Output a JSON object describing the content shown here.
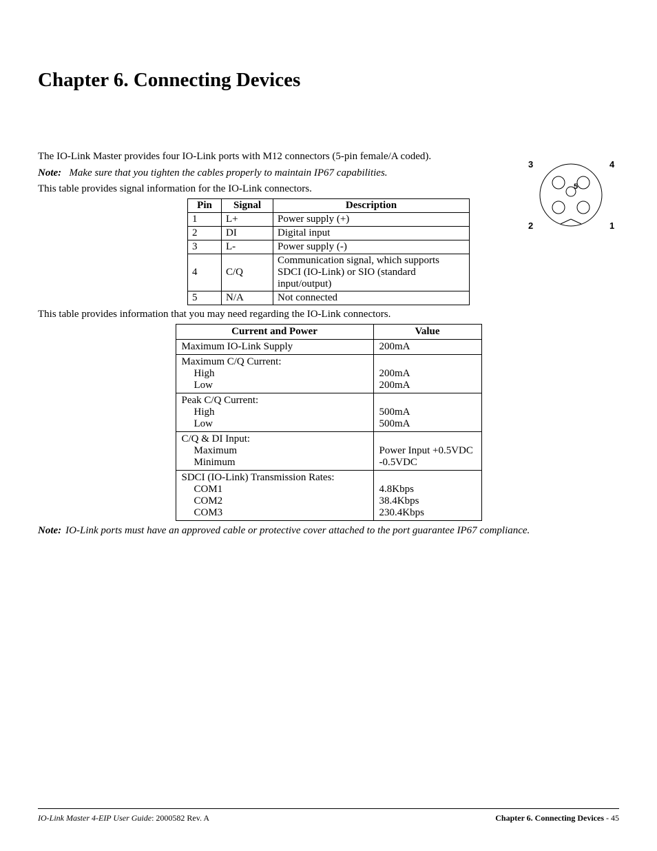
{
  "title": "Chapter 6.  Connecting Devices",
  "intro": "The IO-Link Master provides four IO-Link ports with M12 connectors (5-pin female/A coded).",
  "note_label": "Note:",
  "note1": "Make sure that you tighten the cables properly to maintain IP67 capabilities.",
  "sig_caption": "This table provides signal information for the IO-Link connectors.",
  "sig_headers": {
    "pin": "Pin",
    "signal": "Signal",
    "desc": "Description"
  },
  "sig_rows": [
    {
      "pin": "1",
      "signal": "L+",
      "desc": "Power supply (+)"
    },
    {
      "pin": "2",
      "signal": "DI",
      "desc": "Digital input"
    },
    {
      "pin": "3",
      "signal": "L-",
      "desc": "Power supply (-)"
    },
    {
      "pin": "4",
      "signal": "C/Q",
      "desc": "Communication signal, which supports SDCI (IO-Link) or SIO (standard input/output)"
    },
    {
      "pin": "5",
      "signal": "N/A",
      "desc": "Not connected"
    }
  ],
  "val_caption": "This table provides information that you may need regarding the IO-Link connectors.",
  "val_headers": {
    "param": "Current and Power",
    "value": "Value"
  },
  "val_rows": [
    {
      "param_main": "Maximum IO-Link Supply",
      "param_subs": [],
      "values": [
        "200mA"
      ]
    },
    {
      "param_main": "Maximum C/Q Current:",
      "param_subs": [
        "High",
        "Low"
      ],
      "values": [
        "200mA",
        "200mA"
      ]
    },
    {
      "param_main": "Peak C/Q Current:",
      "param_subs": [
        "High",
        "Low"
      ],
      "values": [
        "500mA",
        "500mA"
      ]
    },
    {
      "param_main": "C/Q & DI Input:",
      "param_subs": [
        "Maximum",
        "Minimum"
      ],
      "values": [
        "Power Input +0.5VDC",
        "-0.5VDC"
      ]
    },
    {
      "param_main": "SDCI (IO-Link) Transmission Rates:",
      "param_subs": [
        "COM1",
        "COM2",
        "COM3"
      ],
      "values": [
        "4.8Kbps",
        "38.4Kbps",
        "230.4Kbps"
      ]
    }
  ],
  "note2": "IO-Link ports must have an approved cable or protective cover attached to the port guarantee IP67 compliance.",
  "diagram_labels": {
    "p1": "1",
    "p2": "2",
    "p3": "3",
    "p4": "4",
    "p5": "5"
  },
  "footer": {
    "left_ital": "IO-Link Master 4-EIP User Guide",
    "left_rest": ": 2000582 Rev. A",
    "right_bold": "Chapter 6. Connecting Devices",
    "right_rest": "  - 45"
  }
}
